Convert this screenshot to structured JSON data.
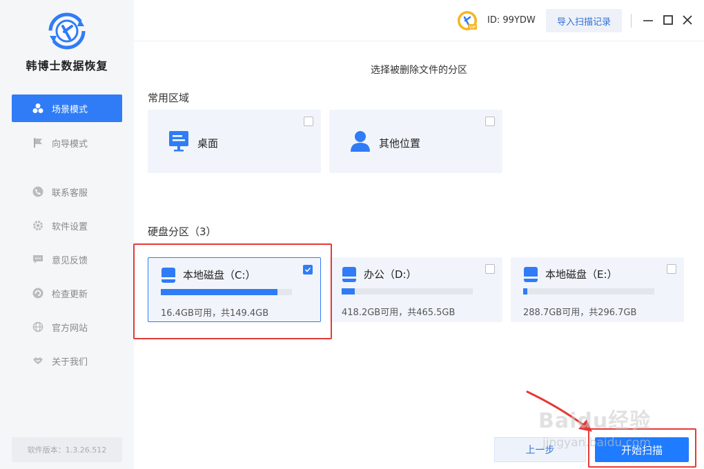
{
  "app": {
    "name": "韩博士数据恢复",
    "version": "软件版本：1.3.26.512"
  },
  "sidebar": {
    "items": [
      {
        "label": "场景模式",
        "icon": "cluster-icon",
        "active": true
      },
      {
        "label": "向导模式",
        "icon": "flag-icon",
        "active": false
      },
      {
        "label": "联系客服",
        "icon": "phone-icon",
        "active": false
      },
      {
        "label": "软件设置",
        "icon": "gear-icon",
        "active": false
      },
      {
        "label": "意见反馈",
        "icon": "chat-icon",
        "active": false
      },
      {
        "label": "检查更新",
        "icon": "refresh-icon",
        "active": false
      },
      {
        "label": "官方网站",
        "icon": "globe-icon",
        "active": false
      },
      {
        "label": "关于我们",
        "icon": "handshake-icon",
        "active": false
      }
    ]
  },
  "topbar": {
    "user_id": "ID: 99YDW",
    "vip_badge": "VIP",
    "import_label": "导入扫描记录"
  },
  "main": {
    "title": "选择被删除文件的分区",
    "common_section": "常用区域",
    "locations": [
      {
        "label": "桌面",
        "icon": "monitor-icon",
        "checked": false
      },
      {
        "label": "其他位置",
        "icon": "user-icon",
        "checked": false
      }
    ],
    "disk_section": "硬盘分区（3）",
    "disks": [
      {
        "name": "本地磁盘（C:）",
        "size": "16.4GB可用，共149.4GB",
        "used_fraction": 0.89,
        "checked": true
      },
      {
        "name": "办公（D:）",
        "size": "418.2GB可用，共465.5GB",
        "used_fraction": 0.1,
        "checked": false
      },
      {
        "name": "本地磁盘（E:）",
        "size": "288.7GB可用，共296.7GB",
        "used_fraction": 0.03,
        "checked": false
      }
    ]
  },
  "footer": {
    "prev_label": "上一步",
    "start_label": "开始扫描"
  },
  "watermark": {
    "brand": "Baidu经验",
    "url": "jingyan.baidu.com"
  },
  "colors": {
    "accent": "#2f7cf6",
    "highlight": "#e53935",
    "sidebar_bg": "#f5f6f8"
  }
}
